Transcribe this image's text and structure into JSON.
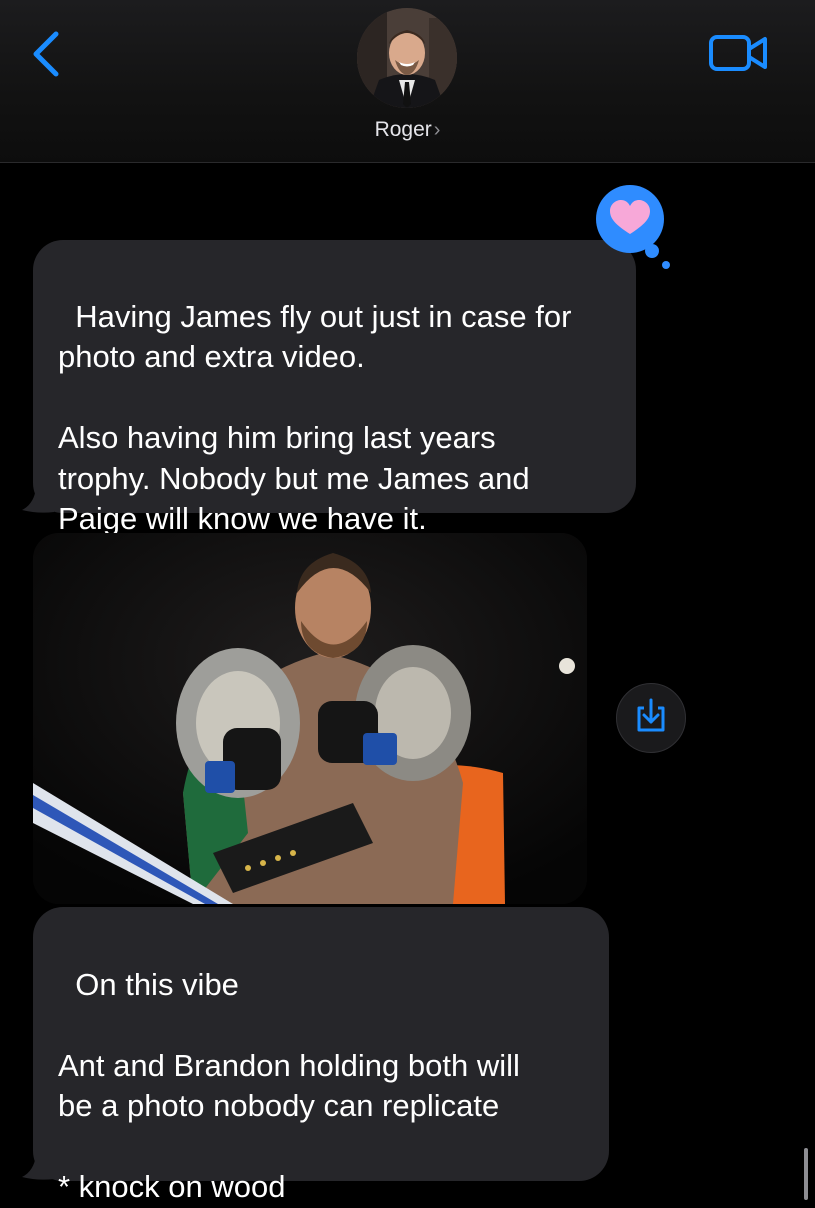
{
  "header": {
    "contact_name": "Roger",
    "chevron": "›",
    "back_icon": "chevron-left-icon",
    "video_icon": "video-camera-icon",
    "accent_color": "#1a8cff"
  },
  "messages": [
    {
      "type": "text",
      "text": "Having James fly out just in case for\nphoto and extra video.\n\nAlso having him bring last years\ntrophy. Nobody but me James and\nPaige will know we have it.",
      "reaction": "heart-icon"
    },
    {
      "type": "image",
      "alt": "image-attachment"
    },
    {
      "type": "text",
      "text": "On this vibe\n\nAnt and Brandon holding both will\nbe a photo nobody can replicate\n\n* knock on wood"
    }
  ],
  "colors": {
    "received_bubble": "#26262a",
    "heart": "#f7a8d8",
    "reaction_bubble": "#2f8cff"
  }
}
